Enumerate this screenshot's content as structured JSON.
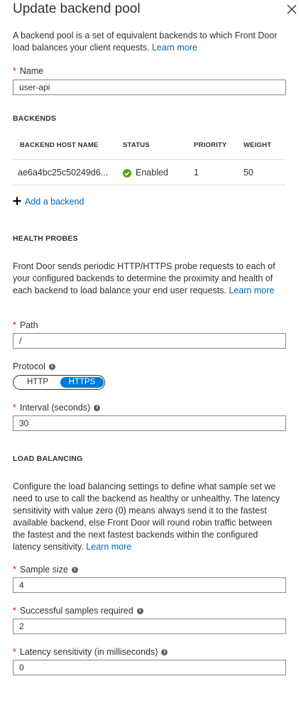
{
  "header": {
    "title": "Update backend pool"
  },
  "intro": {
    "text": "A backend pool is a set of equivalent backends to which Front Door load balances your client requests.",
    "link": "Learn more"
  },
  "name_field": {
    "label": "Name",
    "value": "user-api"
  },
  "backends": {
    "heading": "BACKENDS",
    "columns": [
      "BACKEND HOST NAME",
      "STATUS",
      "PRIORITY",
      "WEIGHT"
    ],
    "rows": [
      {
        "host": "ae6a4bc25c50249d6...",
        "status": "Enabled",
        "priority": "1",
        "weight": "50"
      }
    ],
    "add_label": "Add a backend"
  },
  "health_probes": {
    "heading": "HEALTH PROBES",
    "text": "Front Door sends periodic HTTP/HTTPS probe requests to each of your configured backends to determine the proximity and health of each backend to load balance your end user requests.",
    "link": "Learn more",
    "path": {
      "label": "Path",
      "value": "/"
    },
    "protocol": {
      "label": "Protocol",
      "options": [
        "HTTP",
        "HTTPS"
      ],
      "selected": "HTTPS"
    },
    "interval": {
      "label": "Interval (seconds)",
      "value": "30"
    }
  },
  "load_balancing": {
    "heading": "LOAD BALANCING",
    "text": "Configure the load balancing settings to define what sample set we need to use to call the backend as healthy or unhealthy. The latency sensitivity with value zero (0) means always send it to the fastest available backend, else Front Door will round robin traffic between the fastest and the next fastest backends within the configured latency sensitivity.",
    "link": "Learn more",
    "sample_size": {
      "label": "Sample size",
      "value": "4"
    },
    "successful_samples": {
      "label": "Successful samples required",
      "value": "2"
    },
    "latency": {
      "label": "Latency sensitivity (in milliseconds)",
      "value": "0"
    }
  },
  "colors": {
    "accent": "#0078d4",
    "link": "#0065b3",
    "required": "#e00b1c",
    "status_ok": "#57a300"
  }
}
